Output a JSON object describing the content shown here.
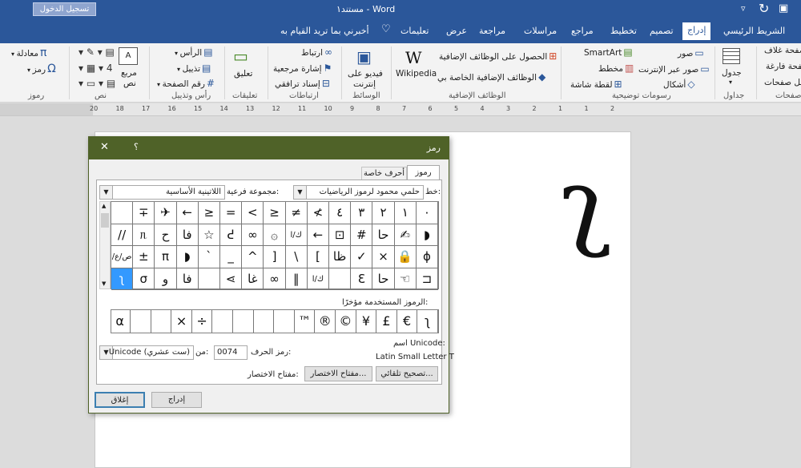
{
  "titlebar": {
    "signin": "تسجيل الدخول",
    "title": "مستند١ - Word",
    "restore_icon": "restore-icon",
    "redo_icon": "redo-icon",
    "save_icon": "save-icon"
  },
  "tabs": {
    "home": "الشريط الرئيسي",
    "insert": "إدراج",
    "design": "تصميم",
    "layout": "تخطيط",
    "references": "مراجع",
    "mailings": "مراسلات",
    "review": "مراجعة",
    "view": "عرض",
    "help": "تعليمات",
    "tellme": "أخبرني بما تريد القيام به"
  },
  "ribbon": {
    "pages": {
      "cover": "صفحة غلاف",
      "blank": "صفحة فارغة",
      "break": "فاصل صفحات",
      "label": "صفحات"
    },
    "tables": {
      "table": "جدول",
      "label": "جداول"
    },
    "illustrations": {
      "pictures": "صور",
      "online_pictures": "صور عبر الإنترنت",
      "shapes": "أشكال",
      "smartart": "SmartArt",
      "chart": "مخطط",
      "screenshot": "لقطة شاشة",
      "label": "رسومات توضيحية"
    },
    "addins": {
      "get": "الحصول على الوظائف الإضافية",
      "my": "الوظائف الإضافية الخاصة بي",
      "wikipedia": "Wikipedia",
      "label": "الوظائف الإضافية"
    },
    "media": {
      "video1": "فيديو على",
      "video2": "إنترنت",
      "label": "الوسائط"
    },
    "links": {
      "link": "ارتباط",
      "bookmark": "إشارة مرجعية",
      "crossref": "إسناد ترافقي",
      "label": "ارتباطات"
    },
    "comments": {
      "comment": "تعليق",
      "label": "تعليقات"
    },
    "headerfooter": {
      "header": "الرأس",
      "footer": "تذييل",
      "pagenumber": "رقم الصفحة",
      "label": "رأس وتذييل"
    },
    "text": {
      "textbox1": "مربع",
      "textbox2": "نص",
      "label": "نص"
    },
    "symbols": {
      "equation": "معادلة",
      "symbol": "رمز",
      "label": "رموز"
    }
  },
  "ruler": {
    "ticks": [
      "20",
      "18",
      "17",
      "16",
      "15",
      "14",
      "13",
      "12",
      "11",
      "10",
      "9",
      "8",
      "7",
      "6",
      "5",
      "4",
      "3",
      "2",
      "1",
      "1",
      "2"
    ]
  },
  "document": {
    "big_glyph": "ʅ"
  },
  "dialog": {
    "title": "رمز",
    "help": "؟",
    "close": "✕",
    "tab_symbols": "رموز",
    "tab_special": "أحرف خاصة",
    "font_label": "خط:",
    "font_value": "حلمي محمود لرموز الرياضيات",
    "subset_label": "مجموعة فرعية:",
    "subset_value": "اللاتينية الأساسية",
    "grid": [
      [
        "٠",
        "١",
        "٢",
        "٣",
        "٤",
        "≮",
        "≠",
        "≥",
        "<",
        "=",
        "≥",
        "←",
        "✈",
        "∓",
        ""
      ],
      [
        "◗",
        "✍",
        "حا",
        "#",
        "⊡",
        "←",
        "ك/ا",
        "۞",
        "∞",
        "ᕍ",
        "☆",
        "فا",
        "ح",
        "ᥰ",
        "//"
      ],
      [
        "ɸ",
        "🔒",
        "×",
        "✓",
        "ظا",
        "[",
        "\\",
        "]",
        "^",
        "_",
        "`",
        "◗",
        "π",
        "±",
        "ص/ع/س"
      ],
      [
        "⊐",
        "☜",
        "حا",
        "Ɛ",
        "",
        "ك/ا",
        "‖",
        "∞",
        "غا",
        "⋖",
        "",
        "فا",
        "و",
        "σ",
        "ʅ"
      ]
    ],
    "recent_label": "الرموز المستخدمة مؤخرًا:",
    "recent": [
      "ʅ",
      "€",
      "£",
      "¥",
      "©",
      "®",
      "™",
      "",
      "",
      "",
      "",
      "÷",
      "×",
      "",
      "",
      "α"
    ],
    "unicode_name_label": "اسم Unicode:",
    "unicode_name": "Latin Small Letter T",
    "charcode_label": "رمز الحرف:",
    "charcode_value": "0074",
    "from_label": "من:",
    "from_value": "Unicode (ست عشري)",
    "autocorrect": "تصحيح تلقائي...",
    "shortcut_key": "مفتاح الاختصار...",
    "shortcut_label": "مفتاح الاختصار:",
    "insert": "إدراج",
    "close_btn": "إغلاق"
  }
}
